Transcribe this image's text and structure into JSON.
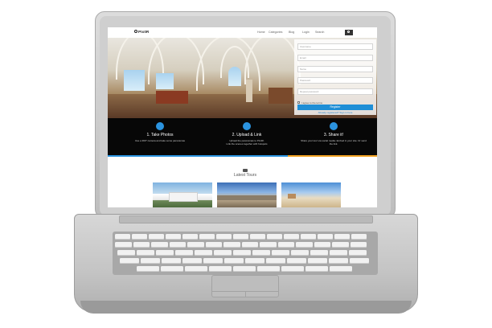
{
  "site": {
    "logo_text": "PIx0R",
    "nav": [
      "Home",
      "Categories",
      "Blog",
      "Login",
      "Search"
    ]
  },
  "register_form": {
    "fields": [
      "Username",
      "Email",
      "Name",
      "Password",
      "Repeat password"
    ],
    "agree_text": "I agree to the terms",
    "button_label": "Register",
    "login_link": "Already registered? Sign in here"
  },
  "steps": [
    {
      "title": "1. Take Photos",
      "desc": [
        "Use a 360° camera and take some panoramas"
      ]
    },
    {
      "title": "2. Upload & Link",
      "desc": [
        "Upload the panoramas to Pix4R.",
        "Link the scenes together with hotspots"
      ]
    },
    {
      "title": "3. Share it!",
      "desc": [
        "Share your tour via social media. Embed in your site. Or send",
        "the link."
      ]
    }
  ],
  "strip_colors": [
    "#2b93df",
    "#2b93df",
    "#f0a020"
  ],
  "latest_tours": {
    "title": "Latest Tours",
    "thumbnails": [
      "building-exterior",
      "town-square",
      "beach-scene"
    ]
  }
}
